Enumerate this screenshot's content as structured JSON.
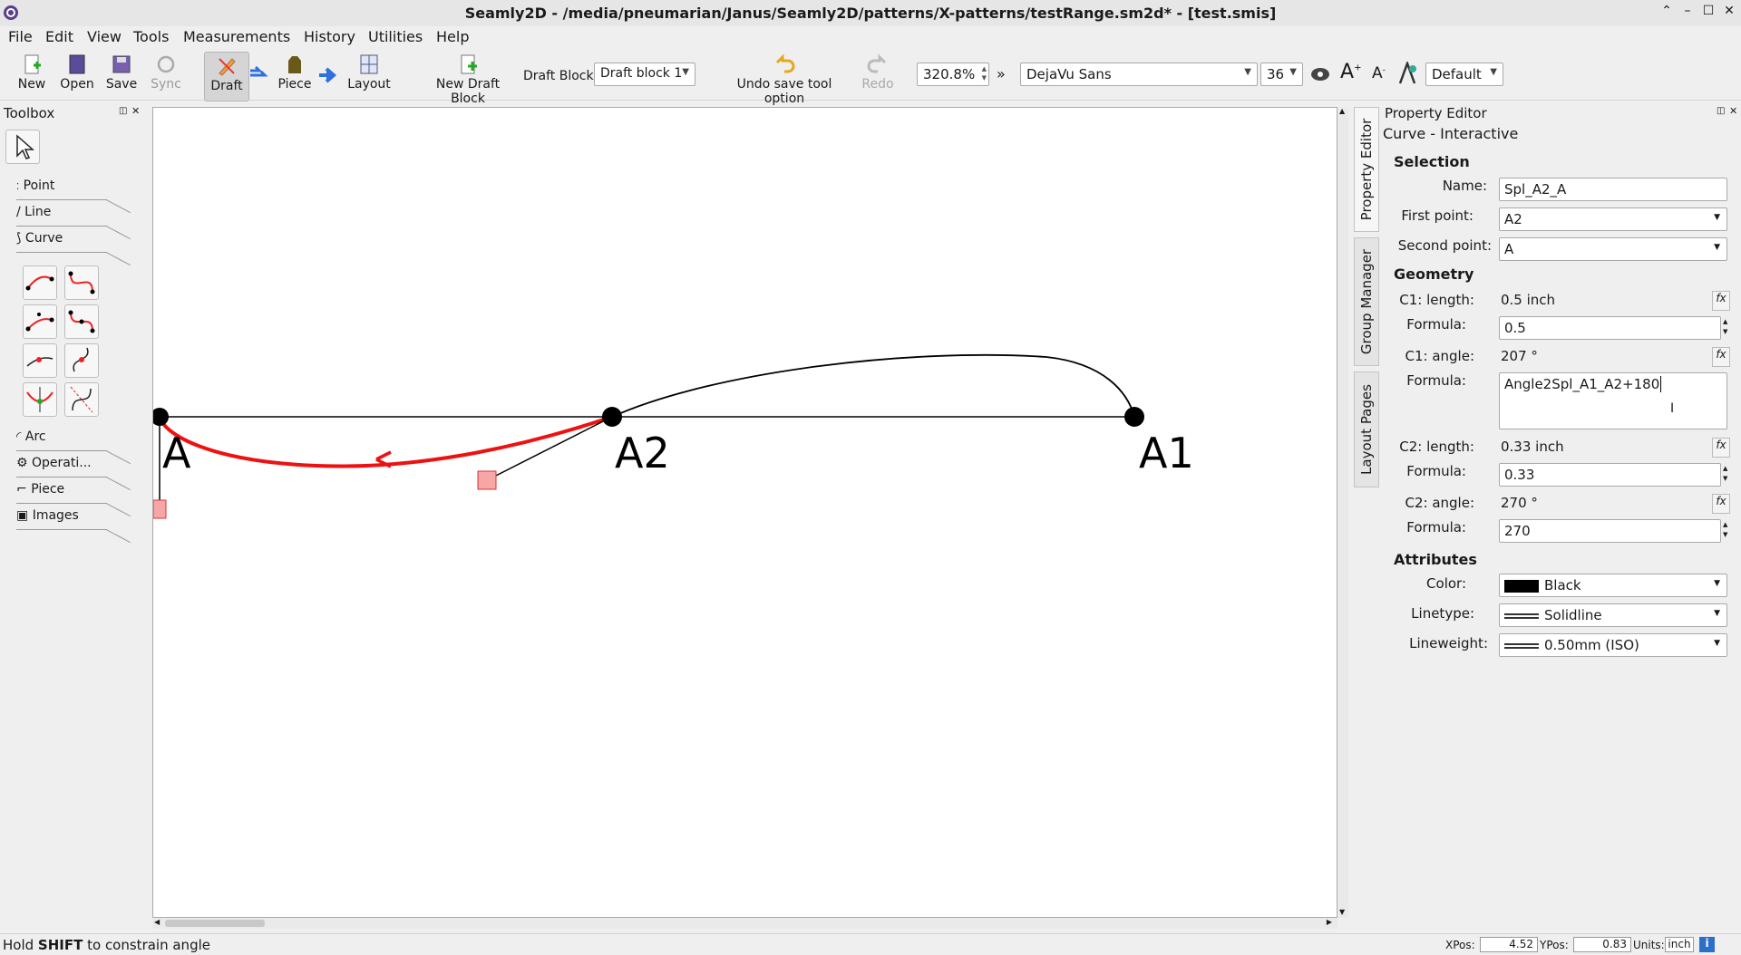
{
  "window": {
    "title": "Seamly2D - /media/pneumarian/Janus/Seamly2D/patterns/X-patterns/testRange.sm2d* - [test.smis]"
  },
  "menu": [
    "File",
    "Edit",
    "View",
    "Tools",
    "Measurements",
    "History",
    "Utilities",
    "Help"
  ],
  "toolbar": {
    "new": "New",
    "open": "Open",
    "save": "Save",
    "sync": "Sync",
    "draft": "Draft",
    "piece": "Piece",
    "layout": "Layout",
    "new_draft_block": "New Draft Block",
    "draft_block_label": "Draft Block:",
    "draft_block_value": "Draft block 1",
    "undo": "Undo save tool option",
    "redo": "Redo",
    "zoom": "320.8%",
    "font": "DejaVu Sans",
    "font_size": "36",
    "style": "Default"
  },
  "toolbox": {
    "title": "Toolbox",
    "categories": [
      "Point",
      "Line",
      "Curve",
      "Arc",
      "Operati...",
      "Piece",
      "Images"
    ]
  },
  "canvas": {
    "points": [
      {
        "label": "A"
      },
      {
        "label": "A2"
      },
      {
        "label": "A1"
      }
    ]
  },
  "side_tabs": [
    "Property Editor",
    "Group Manager",
    "Layout Pages"
  ],
  "property_editor": {
    "title": "Property Editor",
    "subtitle": "Curve - Interactive",
    "selection": "Selection",
    "name_label": "Name:",
    "name": "Spl_A2_A",
    "first_point_label": "First point:",
    "first_point": "A2",
    "second_point_label": "Second point:",
    "second_point": "A",
    "geometry": "Geometry",
    "c1_length_label": "C1: length:",
    "c1_length": "0.5 inch",
    "formula_label": "Formula:",
    "c1_length_formula": "0.5",
    "c1_angle_label": "C1: angle:",
    "c1_angle": "207 °",
    "c1_angle_formula": "Angle2Spl_A1_A2+180",
    "c2_length_label": "C2: length:",
    "c2_length": "0.33 inch",
    "c2_length_formula": "0.33",
    "c2_angle_label": "C2: angle:",
    "c2_angle": "270 °",
    "c2_angle_formula": "270",
    "attributes": "Attributes",
    "color_label": "Color:",
    "color": "Black",
    "linetype_label": "Linetype:",
    "linetype": "Solidline",
    "lineweight_label": "Lineweight:",
    "lineweight": "0.50mm (ISO)"
  },
  "status": {
    "message_bold": "SHIFT",
    "message_pre": "Hold ",
    "message_post": " to constrain angle",
    "xpos_label": "XPos:",
    "xpos": "4.52",
    "ypos_label": "YPos:",
    "ypos": "0.83",
    "units_label": "Units:",
    "units": "inch"
  },
  "colors": {
    "accent_curve": "#ee1111",
    "point": "#000000",
    "handle": "#f7a6a6"
  }
}
